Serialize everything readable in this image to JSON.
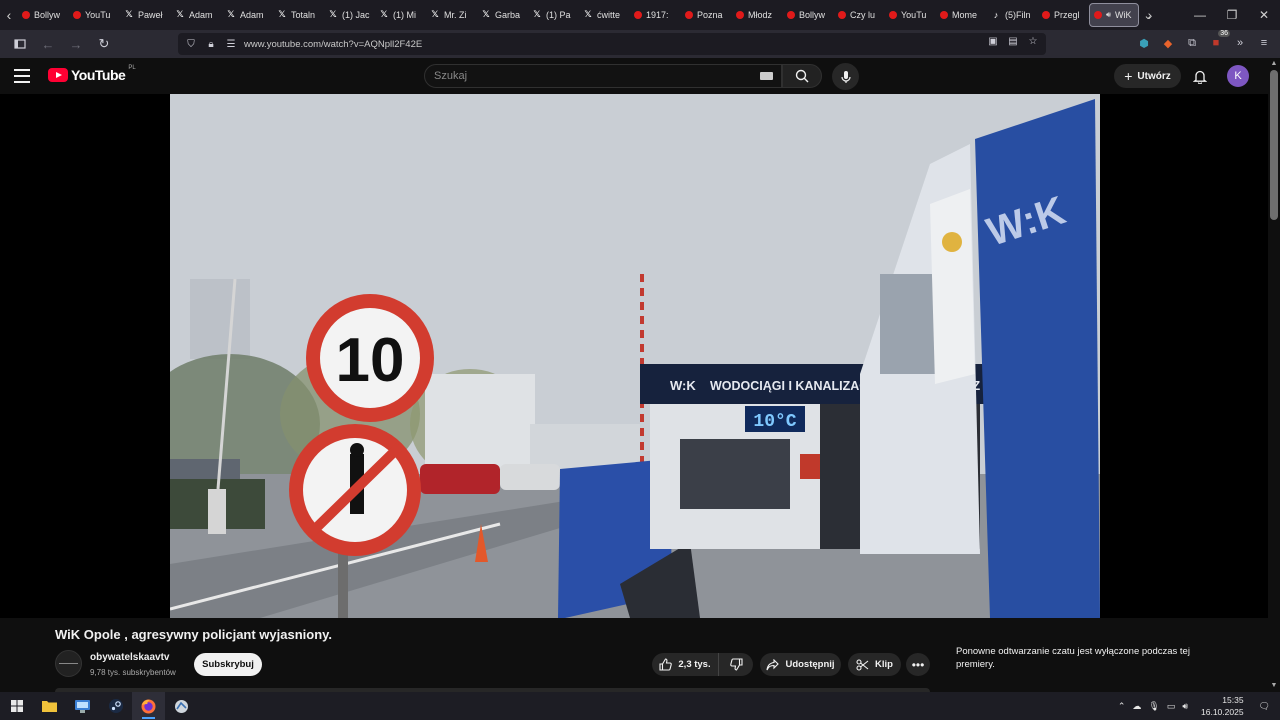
{
  "browser": {
    "tabs": [
      {
        "label": "Bollyw",
        "favicon": "youtube-icon"
      },
      {
        "label": "YouTu",
        "favicon": "youtube-icon"
      },
      {
        "label": "Paweł",
        "favicon": "x-icon"
      },
      {
        "label": "Adam",
        "favicon": "x-icon"
      },
      {
        "label": "Adam",
        "favicon": "x-icon"
      },
      {
        "label": "Totaln",
        "favicon": "x-icon"
      },
      {
        "label": "(1) Jac",
        "favicon": "x-icon"
      },
      {
        "label": "(1) Mi",
        "favicon": "x-icon"
      },
      {
        "label": "Mr. Zi",
        "favicon": "x-icon"
      },
      {
        "label": "Garba",
        "favicon": "x-icon"
      },
      {
        "label": "(1) Pa",
        "favicon": "x-icon"
      },
      {
        "label": "ćwitte",
        "favicon": "x-icon"
      },
      {
        "label": "1917:",
        "favicon": "youtube-icon"
      },
      {
        "label": "Pozna",
        "favicon": "youtube-icon"
      },
      {
        "label": "Młodz",
        "favicon": "youtube-icon"
      },
      {
        "label": "Bollyw",
        "favicon": "youtube-icon"
      },
      {
        "label": "Czy lu",
        "favicon": "youtube-icon"
      },
      {
        "label": "YouTu",
        "favicon": "youtube-icon"
      },
      {
        "label": "Mome",
        "favicon": "youtube-icon"
      },
      {
        "label": "(5)Filn",
        "favicon": "tiktok-icon"
      },
      {
        "label": "Przegl",
        "favicon": "youtube-icon"
      }
    ],
    "active_tab": {
      "label": "WiK",
      "favicon": "youtube-icon"
    },
    "url": "www.youtube.com/watch?v=AQNpll2F42E",
    "extension_badge": "36"
  },
  "youtube": {
    "logo_text": "YouTube",
    "region": "PL",
    "search_placeholder": "Szukaj",
    "create_label": "Utwórz",
    "avatar_letter": "K",
    "accent_color": "#ff0033"
  },
  "video": {
    "sign_speed": "10",
    "building_sign": "WODOCIĄGI I KANALIZACJA W OPOLU SP. Z O",
    "temperature": "10°C",
    "title": "WiK Opole , agresywny policjant wyjasniony.",
    "channel_name": "obywatelskaavtv",
    "channel_subs": "9,78 tys. subskrybentów",
    "subscribe_label": "Subskrybuj",
    "likes": "2,3 tys.",
    "share_label": "Udostępnij",
    "clip_label": "Klip",
    "chat_message": "Ponowne odtwarzanie czatu jest wyłączone podczas tej premiery."
  },
  "taskbar": {
    "time": "15:35",
    "date": "16.10.2025"
  }
}
